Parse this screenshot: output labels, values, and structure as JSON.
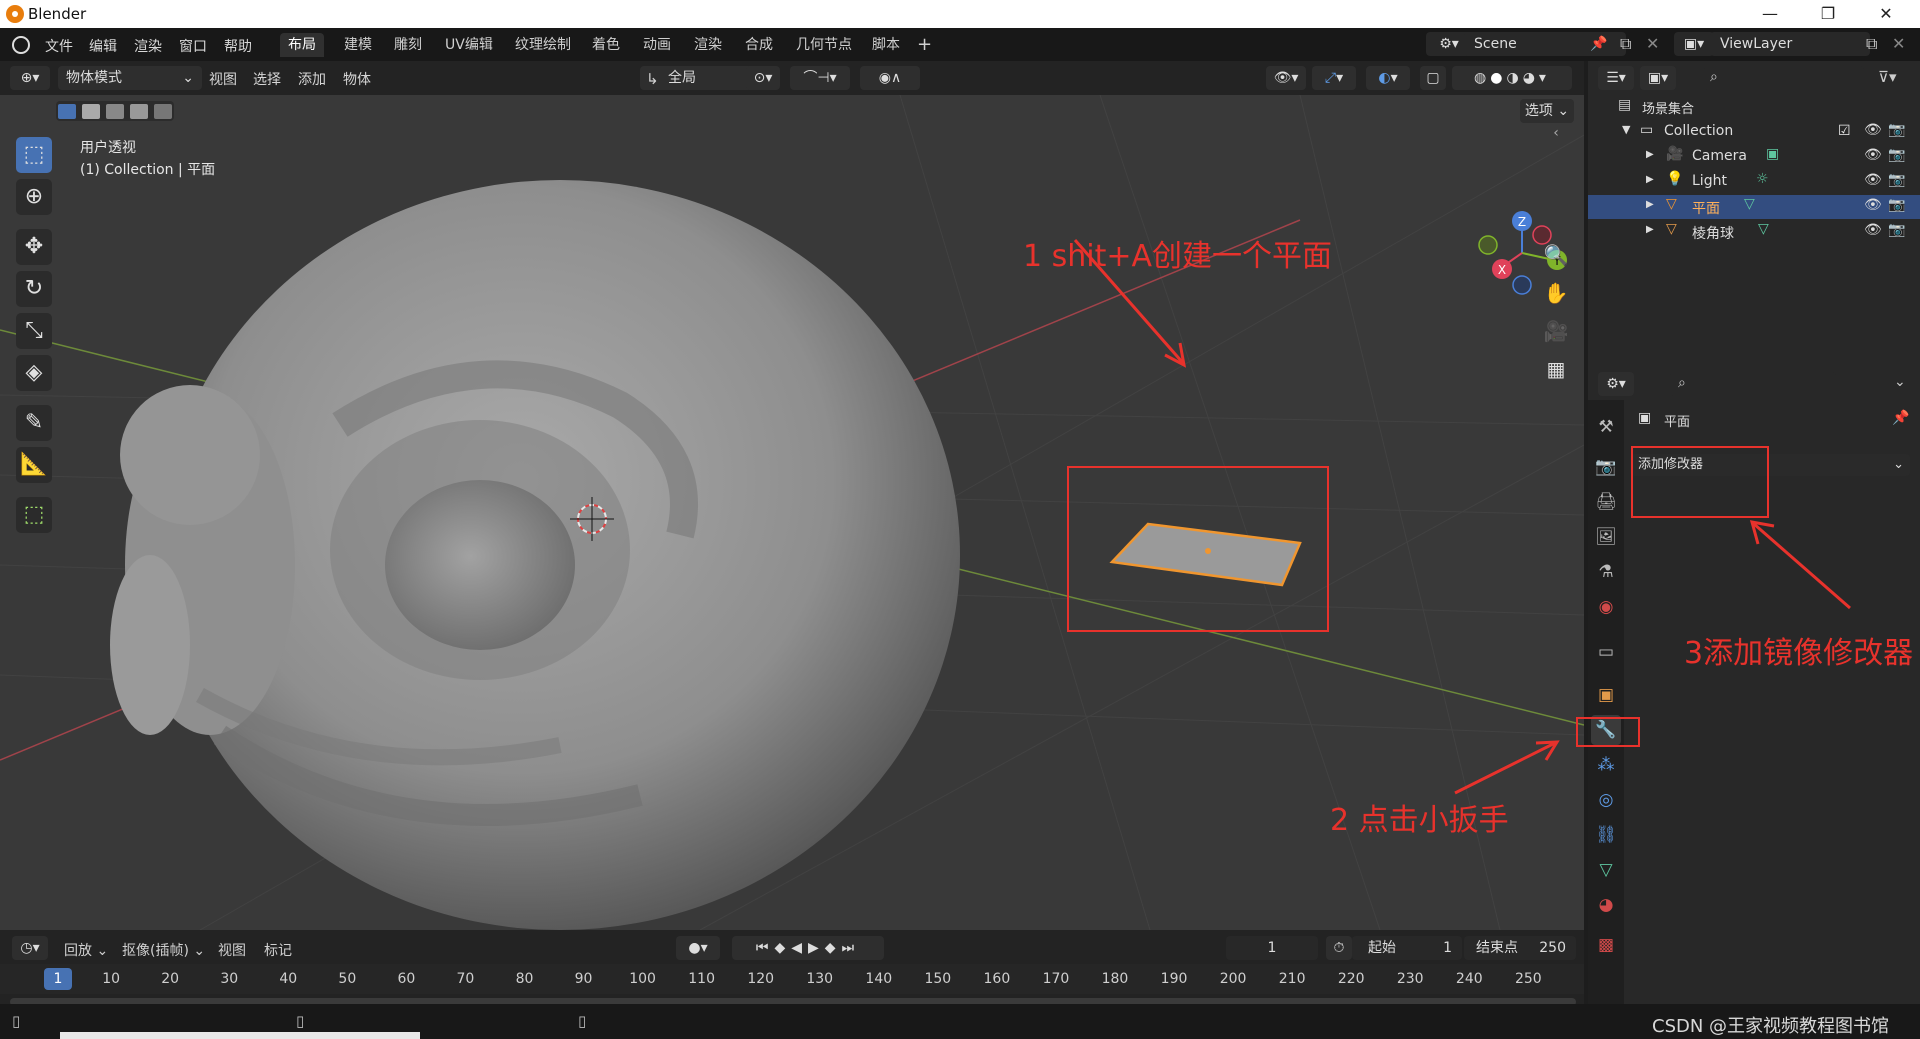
{
  "app": {
    "title": "Blender",
    "window_controls": {
      "minimize": "—",
      "restore": "❐",
      "close": "✕"
    }
  },
  "menu": [
    "文件",
    "编辑",
    "渲染",
    "窗口",
    "帮助"
  ],
  "workspaces": {
    "tabs": [
      "布局",
      "建模",
      "雕刻",
      "UV编辑",
      "纹理绘制",
      "着色",
      "动画",
      "渲染",
      "合成",
      "几何节点",
      "脚本"
    ],
    "active": "布局",
    "add": "+"
  },
  "scene": {
    "name": "Scene",
    "view_layer": "ViewLayer"
  },
  "viewport_header": {
    "mode": "物体模式",
    "menus": [
      "视图",
      "选择",
      "添加",
      "物体"
    ],
    "transform_orientation": "全局",
    "options": "选项"
  },
  "viewport": {
    "view_name": "用户透视",
    "view_info": "(1) Collection | 平面",
    "gizmo_axes": {
      "x": "X",
      "y": "Y",
      "z": "Z"
    }
  },
  "annotations": {
    "step1": "1 shit+A创建一个平面",
    "step2": "2 点击小扳手",
    "step3": "3添加镜像修改器"
  },
  "outliner": {
    "root": "场景集合",
    "collection": "Collection",
    "items": [
      {
        "label": "Camera"
      },
      {
        "label": "Light"
      },
      {
        "label": "平面"
      },
      {
        "label": "棱角球"
      }
    ]
  },
  "properties": {
    "object_name": "平面",
    "add_modifier": "添加修改器",
    "active_tab": "wrench-icon"
  },
  "timeline": {
    "playback": "回放",
    "keying": "抠像(插帧)",
    "menus": [
      "视图",
      "标记"
    ],
    "current_frame": "1",
    "start_label": "起始",
    "start": "1",
    "end_label": "结束点",
    "end": "250",
    "ruler": [
      "1",
      "10",
      "20",
      "30",
      "40",
      "50",
      "60",
      "70",
      "80",
      "90",
      "100",
      "110",
      "120",
      "130",
      "140",
      "150",
      "160",
      "170",
      "180",
      "190",
      "200",
      "210",
      "220",
      "230",
      "240",
      "250"
    ]
  },
  "watermark": "CSDN @王家视频教程图书馆",
  "colors": {
    "accent": "#4772b3",
    "annotation": "#e8322c",
    "selected_object": "#f0962f"
  }
}
